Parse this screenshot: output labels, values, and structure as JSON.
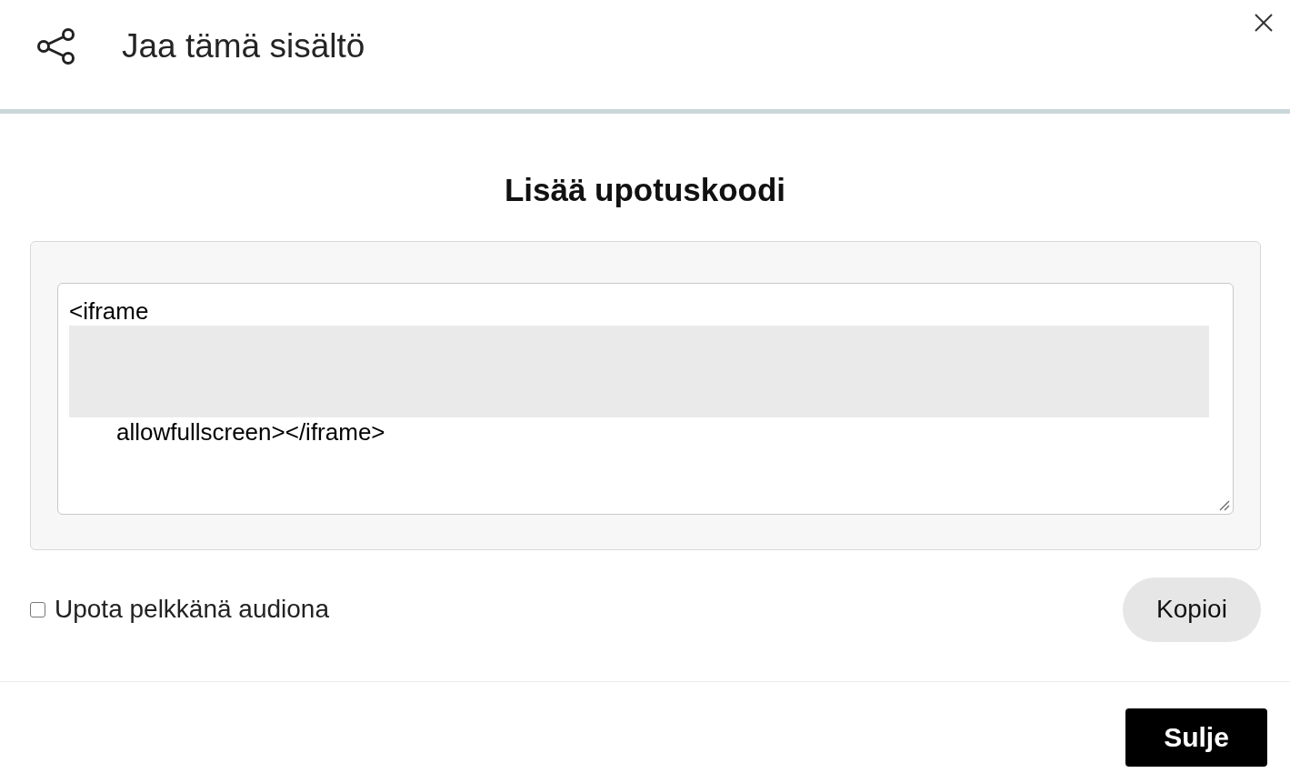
{
  "dialog": {
    "title": "Jaa tämä sisältö"
  },
  "embed": {
    "heading": "Lisää upotuskoodi",
    "code_lines": [
      {
        "kind": "text",
        "text": "<iframe"
      },
      {
        "kind": "redacted"
      },
      {
        "kind": "indented",
        "text": "allowfullscreen></iframe>"
      }
    ]
  },
  "audio_only": {
    "label": "Upota pelkkänä audiona",
    "checked": false
  },
  "copy_button": "Kopioi",
  "close_button": "Sulje"
}
